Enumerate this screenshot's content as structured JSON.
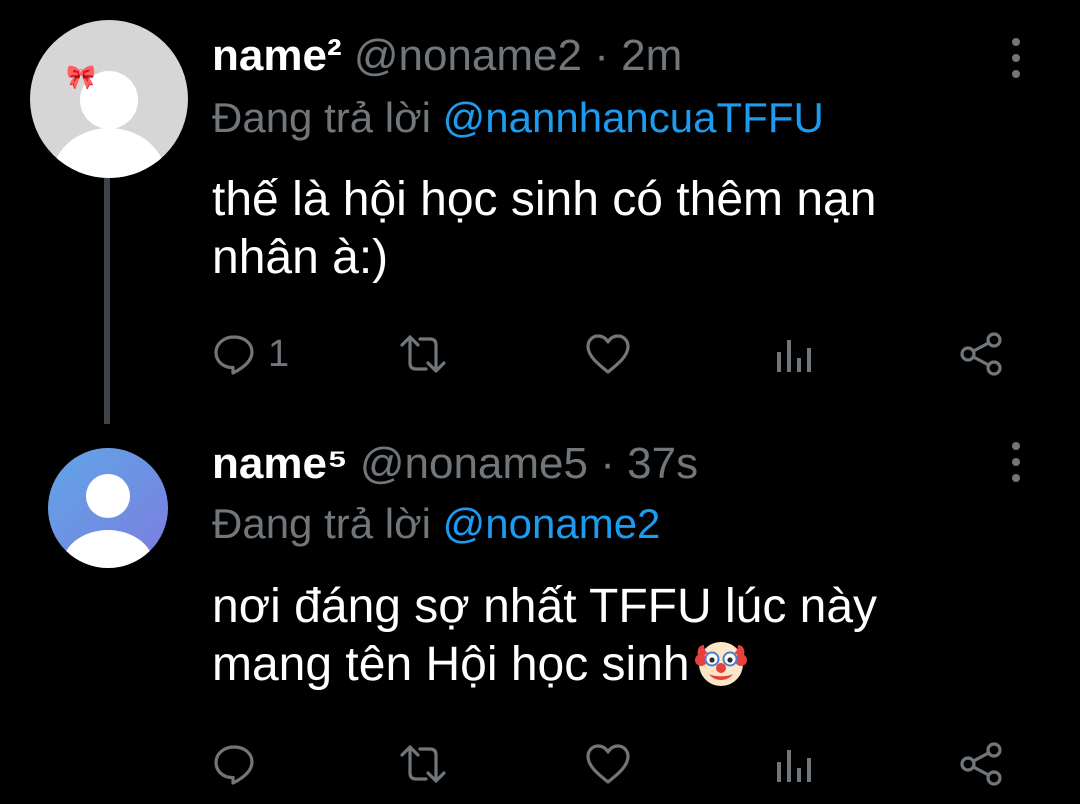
{
  "tweets": [
    {
      "name": "name²",
      "handle": "@noname2",
      "separator": "·",
      "time": "2m",
      "reply_prefix": "Đang trả lời ",
      "reply_to": "@nannhancuaTFFU",
      "text_line1": "thế là hội học sinh có thêm nạn",
      "text_line2": "nhân à:)",
      "reply_count": "1",
      "avatar_icon": "bow-icon"
    },
    {
      "name": "name⁵",
      "handle": "@noname5",
      "separator": "·",
      "time": "37s",
      "reply_prefix": "Đang trả lời ",
      "reply_to": "@noname2",
      "text_line1": "nơi đáng sợ nhất TFFU lúc này",
      "text_line2": "mang tên Hội học sinh",
      "emoji": "clown-face-emoji",
      "reply_count": ""
    }
  ],
  "icons": {
    "reply": "reply-icon",
    "retweet": "retweet-icon",
    "like": "like-icon",
    "views": "views-icon",
    "share": "share-icon",
    "more": "more-icon"
  },
  "colors": {
    "background": "#000000",
    "text": "#ffffff",
    "muted": "#71767b",
    "mention": "#1d9bf0",
    "thread_line": "#3d4349"
  }
}
